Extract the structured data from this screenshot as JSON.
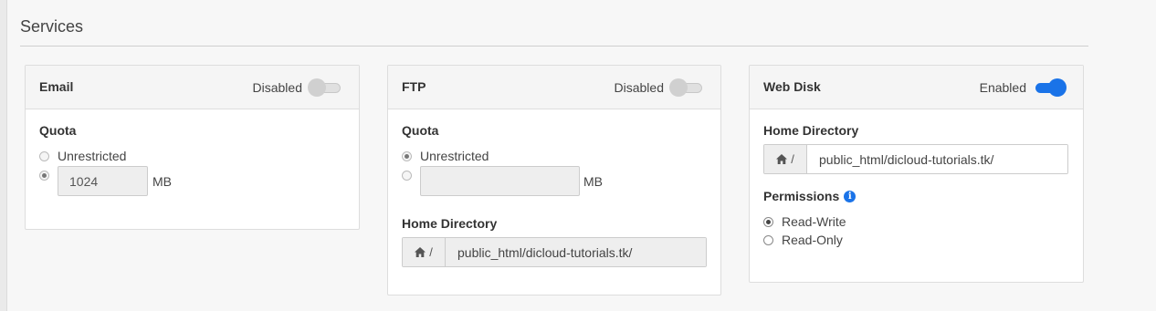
{
  "section": {
    "title": "Services"
  },
  "email": {
    "title": "Email",
    "toggle_label": "Disabled",
    "quota_label": "Quota",
    "unrestricted_label": "Unrestricted",
    "quota_value": "1024",
    "unit": "MB"
  },
  "ftp": {
    "title": "FTP",
    "toggle_label": "Disabled",
    "quota_label": "Quota",
    "unrestricted_label": "Unrestricted",
    "quota_value": "",
    "unit": "MB",
    "home_dir_label": "Home Directory",
    "home_prefix": "/",
    "home_dir_value": "public_html/dicloud-tutorials.tk/"
  },
  "webdisk": {
    "title": "Web Disk",
    "toggle_label": "Enabled",
    "home_dir_label": "Home Directory",
    "home_prefix": "/",
    "home_dir_value": "public_html/dicloud-tutorials.tk/",
    "permissions_label": "Permissions",
    "perm_read_write": "Read-Write",
    "perm_read_only": "Read-Only"
  },
  "colors": {
    "accent": "#1a73e8"
  }
}
